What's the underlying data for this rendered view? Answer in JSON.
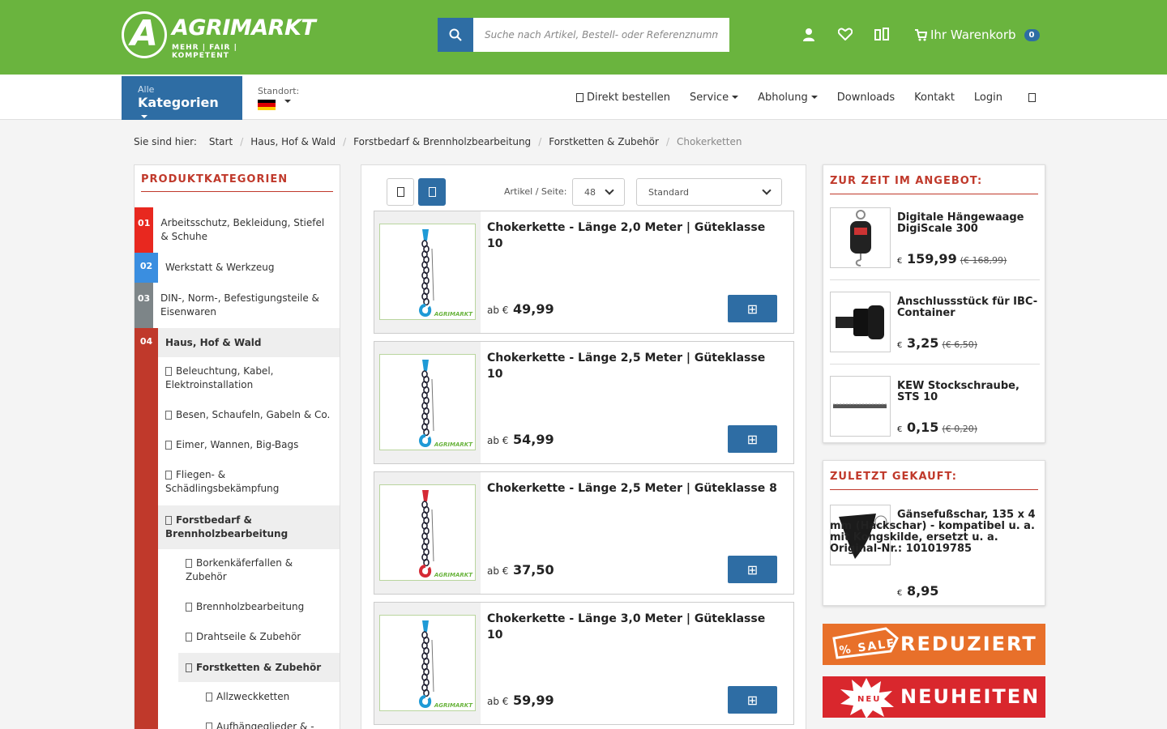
{
  "header": {
    "logo_letter": "A",
    "logo_name": "AGRIMARKT",
    "logo_tagline": "MEHR | FAIR | KOMPETENT",
    "search_placeholder": "Suche nach Artikel, Bestell- oder Referenznummer",
    "cart_label": "Ihr Warenkorb",
    "cart_count": "0"
  },
  "nav": {
    "categories_small": "Alle",
    "categories_big": "Kategorien",
    "standort_label": "Standort:",
    "links": [
      "Direkt bestellen",
      "Service",
      "Abholung",
      "Downloads",
      "Kontakt",
      "Login"
    ]
  },
  "breadcrumb": {
    "label": "Sie sind hier:",
    "items": [
      "Start",
      "Haus, Hof & Wald",
      "Forstbedarf & Brennholzbearbeitung",
      "Forstketten & Zubehör"
    ],
    "current": "Chokerketten"
  },
  "sidebar": {
    "title": "PRODUKTKATEGORIEN",
    "categories": [
      {
        "num": "01",
        "label": "Arbeitsschutz, Bekleidung, Stiefel & Schuhe",
        "color": "#e8281f"
      },
      {
        "num": "02",
        "label": "Werkstatt & Werkzeug",
        "color": "#3a8ee0"
      },
      {
        "num": "03",
        "label": "DIN-, Norm-, Befestigungsteile & Eisenwaren",
        "color": "#7d8588"
      },
      {
        "num": "04",
        "label": "Haus, Hof & Wald",
        "color": "#c0392b"
      }
    ],
    "subcategories": [
      "Beleuchtung, Kabel, Elektroinstallation",
      "Besen, Schaufeln, Gabeln & Co.",
      "Eimer, Wannen, Big-Bags",
      "Fliegen- & Schädlingsbekämpfung",
      "Forstbedarf & Brennholzbearbeitung"
    ],
    "subsub": [
      "Borkenkäferfallen & Zubehör",
      "Brennholzbearbeitung",
      "Drahtseile & Zubehör",
      "Forstketten & Zubehör"
    ],
    "subsubsub": [
      "Allzweckketten",
      "Aufhängeglieder & -"
    ]
  },
  "listing": {
    "per_page_label": "Artikel / Seite:",
    "per_page_value": "48",
    "sort_value": "Standard",
    "products": [
      {
        "title": "Chokerkette - Länge 2,0 Meter | Güteklasse 10",
        "ab": "ab €",
        "price": "49,99",
        "color": "#1e9ad6"
      },
      {
        "title": "Chokerkette - Länge 2,5 Meter | Güteklasse 10",
        "ab": "ab €",
        "price": "54,99",
        "color": "#1e9ad6"
      },
      {
        "title": "Chokerkette - Länge 2,5 Meter | Güteklasse 8",
        "ab": "ab €",
        "price": "37,50",
        "color": "#d52a35"
      },
      {
        "title": "Chokerkette - Länge 3,0 Meter | Güteklasse 10",
        "ab": "ab €",
        "price": "59,99",
        "color": "#1e9ad6"
      }
    ],
    "watermark": "AGRIMARKT"
  },
  "offers": {
    "title": "ZUR ZEIT IM ANGEBOT:",
    "items": [
      {
        "title": "Digitale Hängewaage DigiScale 300",
        "eur": "€",
        "price": "159,99",
        "old": "(€ 168,99)"
      },
      {
        "title": "Anschlussstück für IBC-Container",
        "eur": "€",
        "price": "3,25",
        "old": "(€ 6,50)"
      },
      {
        "title": "KEW Stockschraube, STS 10",
        "eur": "€",
        "price": "0,15",
        "old": "(€ 0,20)"
      }
    ]
  },
  "recent": {
    "title": "ZULETZT GEKAUFT:",
    "item": {
      "title": "Gänsefußschar, 135 x 4 mm (Hackschar) - kompatibel u. a. mit Kongskilde, ersetzt u. a. Original-Nr.: 101019785",
      "eur": "€",
      "price": "8,95"
    }
  },
  "banners": {
    "sale_tag": "% SALE",
    "sale_text": "REDUZIERT",
    "new_tag": "NEU",
    "new_text": "NEUHEITEN"
  },
  "colors": {
    "brand_green": "#6ab43e",
    "brand_blue": "#2e6da4",
    "accent_red": "#c0392b"
  }
}
